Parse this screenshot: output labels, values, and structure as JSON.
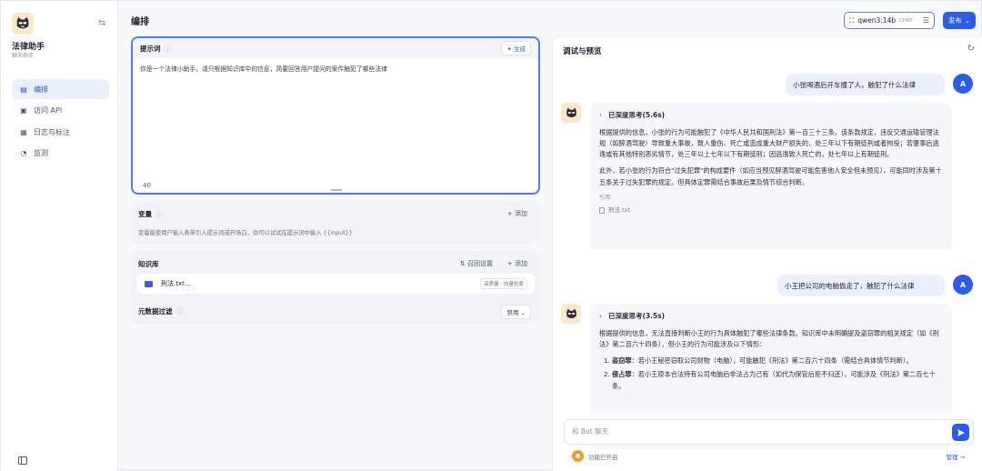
{
  "sidebar": {
    "app_name": "法律助手",
    "app_type": "聊天助手",
    "items": [
      {
        "label": "编排",
        "active": true
      },
      {
        "label": "访问 API",
        "active": false
      },
      {
        "label": "日志与标注",
        "active": false
      },
      {
        "label": "监测",
        "active": false
      }
    ]
  },
  "header": {
    "title": "编排",
    "model_name": "qwen3:14b",
    "model_tag": "CHAT",
    "publish_label": "发布"
  },
  "prompt": {
    "title": "提示词",
    "generate_label": "生成",
    "text": "你是一个法律小助手，请只根据知识库中的信息，简要回答用户提问的案件触犯了哪些法律",
    "char_count": "40"
  },
  "variables": {
    "title": "变量",
    "add_label": "添加",
    "description": "变量能使用户输入表单引入提示词或开场白，你可以试试在提示词中输入 {{input}}"
  },
  "knowledge": {
    "title": "知识库",
    "settings_label": "召回设置",
    "add_label": "添加",
    "file_name": "刑法.txt...",
    "file_tag": "高质量 · 向量检索",
    "metadata_title": "元数据过滤",
    "metadata_value": "禁用"
  },
  "debug": {
    "title": "调试与预览",
    "user_avatar": "A",
    "messages": [
      {
        "user": "小张喝酒后开车撞了人，触犯了什么法律",
        "think": "已深度思考(5.6s)",
        "para1": "根据提供的信息，小张的行为可能触犯了《中华人民共和国刑法》第一百三十三条。该条款规定，违反交通运输管理法规（如醉酒驾驶）导致重大事故，致人重伤、死亡或造成重大财产损失的，处三年以下有期徒刑或者拘役；若肇事后逃逸或有其他特别恶劣情节，处三年以上七年以下有期徒刑；因逃逸致人死亡的，处七年以上有期徒刑。",
        "para2": "此外，若小张的行为符合\"过失犯罪\"的构成要件（如应当预见醉酒驾驶可能危害他人安全但未预见），可能同时涉及第十五条关于过失犯罪的规定。但具体定罪需结合事故后果及情节综合判断。",
        "cite_label": "引用",
        "cite_file": "刑法.txt"
      },
      {
        "user": "小王把公司的电脑偷走了，触犯了什么法律",
        "think": "已深度思考(3.5s)",
        "para1": "根据提供的信息，无法直接判断小王的行为具体触犯了哪些法律条款。知识库中未明确提及盗窃罪的相关规定（如《刑法》第二百六十四条），但小王的行为可能涉及以下情形：",
        "item1_term": "盗窃罪",
        "item1_text": "：若小王秘密窃取公司财物（电脑），可能触犯《刑法》第二百六十四条（需结合具体情节判断）。",
        "item2_term": "侵占罪",
        "item2_text": "：若小王原本合法持有公司电脑后非法占为己有（如代为保管后拒不归还），可能涉及《刑法》第二百七十条。"
      }
    ],
    "input_placeholder": "和 Bot 聊天",
    "feature_label": "功能已开启",
    "manage_label": "管理 →"
  },
  "colors": {
    "accent": "#2b5cf2",
    "active_bg": "#eaf0ff"
  }
}
